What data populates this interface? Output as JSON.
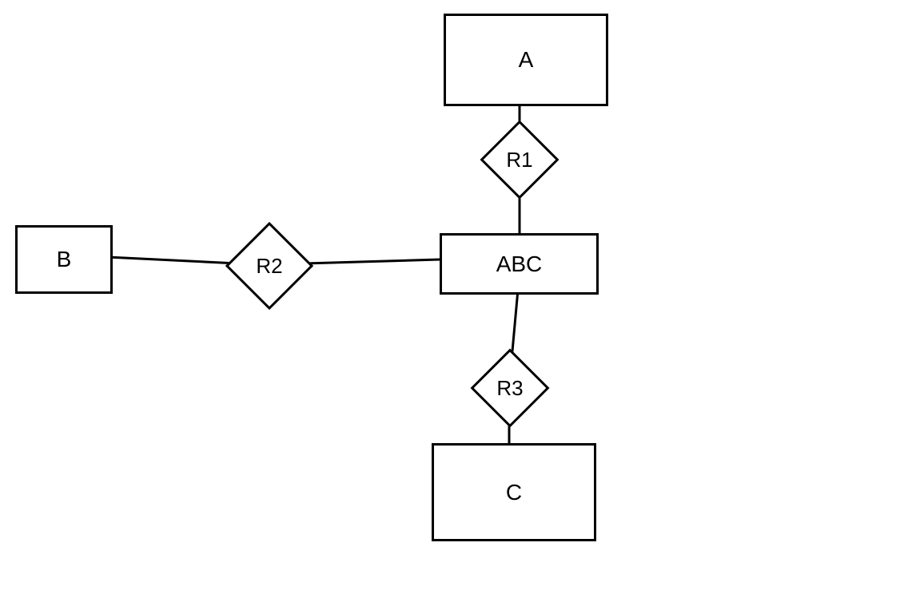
{
  "entities": {
    "A": {
      "label": "A"
    },
    "B": {
      "label": "B"
    },
    "C": {
      "label": "C"
    },
    "ABC": {
      "label": "ABC"
    }
  },
  "relationships": {
    "R1": {
      "label": "R1"
    },
    "R2": {
      "label": "R2"
    },
    "R3": {
      "label": "R3"
    }
  }
}
